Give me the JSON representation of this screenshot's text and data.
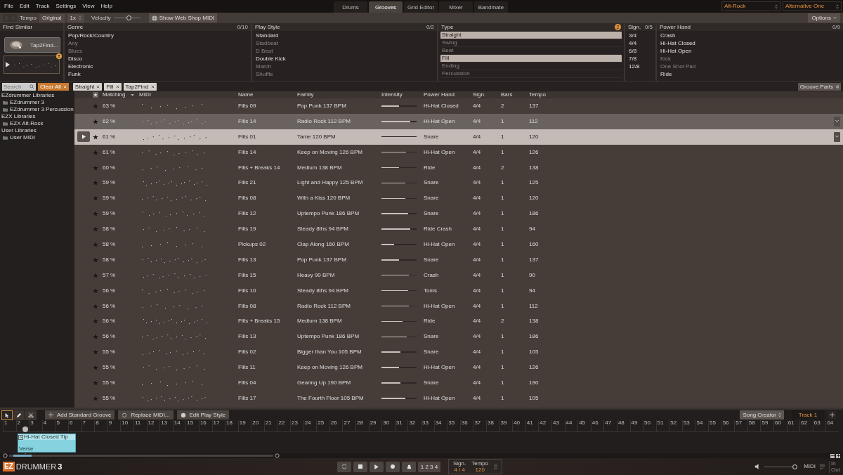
{
  "menu": [
    "File",
    "Edit",
    "Track",
    "Settings",
    "View",
    "Help"
  ],
  "tabs": [
    {
      "label": "Drums",
      "selected": false
    },
    {
      "label": "Grooves",
      "selected": true
    },
    {
      "label": "Grid Editor",
      "selected": false
    },
    {
      "label": "Mixer",
      "selected": false
    },
    {
      "label": "Bandmate",
      "selected": false
    }
  ],
  "presets": [
    "Alt-Rock",
    "Alternative One"
  ],
  "toolbar": {
    "tempo_label": "Tempo",
    "tempo_value": "Original",
    "multiplier": "1x",
    "velocity_label": "Velocity",
    "velocity": {
      "level": 0.55
    },
    "web_shop_button": "Show Web Shop MIDI",
    "options_button": "Options"
  },
  "find_similar": {
    "title": "Find Similar",
    "tap_button": "Tap2Find..."
  },
  "filters": [
    {
      "title": "Genre",
      "count": "0/10",
      "items": [
        {
          "label": "Pop/Rock/Country",
          "disabled": false,
          "selected": false
        },
        {
          "label": "Any",
          "disabled": true,
          "selected": false
        },
        {
          "label": "Blues",
          "disabled": true,
          "selected": false
        },
        {
          "label": "Disco",
          "disabled": false,
          "selected": false
        },
        {
          "label": "Electronic",
          "disabled": false,
          "selected": false
        },
        {
          "label": "Funk",
          "disabled": false,
          "selected": false
        }
      ]
    },
    {
      "title": "Play Style",
      "count": "0/2",
      "items": [
        {
          "label": "Standard",
          "disabled": false,
          "selected": false
        },
        {
          "label": "Stadbeat",
          "disabled": true,
          "selected": false
        },
        {
          "label": "D Beat",
          "disabled": true,
          "selected": false
        },
        {
          "label": "Double Kick",
          "disabled": false,
          "selected": false
        },
        {
          "label": "March",
          "disabled": true,
          "selected": false
        },
        {
          "label": "Shuffle",
          "disabled": true,
          "selected": false
        }
      ]
    },
    {
      "title": "Type",
      "badge": "2",
      "items": [
        {
          "label": "Straight",
          "disabled": false,
          "selected": true
        },
        {
          "label": "Swing",
          "disabled": true,
          "selected": false
        },
        {
          "label": "Beat",
          "disabled": true,
          "selected": false
        },
        {
          "label": "Fill",
          "disabled": false,
          "selected": true
        },
        {
          "label": "Ending",
          "disabled": true,
          "selected": false
        },
        {
          "label": "Percussion",
          "disabled": true,
          "selected": false
        }
      ]
    },
    {
      "title": "Sign.",
      "count": "0/5",
      "items": [
        {
          "label": "3/4",
          "disabled": false,
          "selected": false
        },
        {
          "label": "4/4",
          "disabled": false,
          "selected": false
        },
        {
          "label": "6/8",
          "disabled": false,
          "selected": false
        },
        {
          "label": "7/8",
          "disabled": false,
          "selected": false
        },
        {
          "label": "12/8",
          "disabled": false,
          "selected": false
        }
      ]
    },
    {
      "title": "Power Hand",
      "count": "0/9",
      "items": [
        {
          "label": "Crash",
          "disabled": false,
          "selected": false
        },
        {
          "label": "Hi-Hat Closed",
          "disabled": false,
          "selected": false
        },
        {
          "label": "Hi-Hat Open",
          "disabled": false,
          "selected": false
        },
        {
          "label": "Kick",
          "disabled": true,
          "selected": false
        },
        {
          "label": "One Shot Pad",
          "disabled": true,
          "selected": false
        },
        {
          "label": "Ride",
          "disabled": false,
          "selected": false
        }
      ]
    }
  ],
  "search": {
    "placeholder": "Search"
  },
  "clear_button": "Clear All",
  "tags": [
    "Straight",
    "Fill",
    "Tap2Find"
  ],
  "groove_parts_button": "Groove Parts",
  "libraries": [
    {
      "label": "EZdrummer Libraries",
      "children": [
        {
          "label": "EZdrummer 3"
        },
        {
          "label": "EZdrummer 3 Percussion"
        }
      ]
    },
    {
      "label": "EZX Libraries",
      "children": [
        {
          "label": "EZX Alt-Rock"
        }
      ]
    },
    {
      "label": "User Libraries",
      "children": [
        {
          "label": "User MIDI"
        }
      ]
    }
  ],
  "table": {
    "columns": [
      "Matching",
      "MIDI",
      "Name",
      "Family",
      "Intensity",
      "Power Hand",
      "Sign.",
      "Bars",
      "Tempo"
    ],
    "rows": [
      {
        "matching": "63 %",
        "name": "Fills 09",
        "family": "Pop Punk 137 BPM",
        "level": 0.5,
        "power_hand": "Hi-Hat Closed",
        "sign": "4/4",
        "bars": "2",
        "tempo": "137",
        "selected": false,
        "hovered": false
      },
      {
        "matching": "62 %",
        "name": "Fills 14",
        "family": "Radio Rock 112 BPM",
        "level": 0.82,
        "power_hand": "Hi-Hat Open",
        "sign": "4/4",
        "bars": "1",
        "tempo": "112",
        "selected": false,
        "hovered": true
      },
      {
        "matching": "61 %",
        "name": "Fills 01",
        "family": "Tame 120 BPM",
        "level": 1,
        "power_hand": "Snare",
        "sign": "4/4",
        "bars": "1",
        "tempo": "120",
        "selected": true,
        "hovered": false
      },
      {
        "matching": "61 %",
        "name": "Fills 14",
        "family": "Keep on Moving 126 BPM",
        "level": 0.7,
        "power_hand": "Hi-Hat Open",
        "sign": "4/4",
        "bars": "1",
        "tempo": "126",
        "selected": false,
        "hovered": false
      },
      {
        "matching": "60 %",
        "name": "Fills + Breaks 14",
        "family": "Medium 138 BPM",
        "level": 0.5,
        "power_hand": "Ride",
        "sign": "4/4",
        "bars": "2",
        "tempo": "138",
        "selected": false,
        "hovered": false
      },
      {
        "matching": "59 %",
        "name": "Fills 21",
        "family": "Light and Happy 125 BPM",
        "level": 0.67,
        "power_hand": "Snare",
        "sign": "4/4",
        "bars": "1",
        "tempo": "125",
        "selected": false,
        "hovered": false
      },
      {
        "matching": "59 %",
        "name": "Fills 08",
        "family": "With a Kiss 120 BPM",
        "level": 0.67,
        "power_hand": "Snare",
        "sign": "4/4",
        "bars": "1",
        "tempo": "120",
        "selected": false,
        "hovered": false
      },
      {
        "matching": "59 %",
        "name": "Fills 12",
        "family": "Uptempo Punk 186 BPM",
        "level": 0.75,
        "power_hand": "Snare",
        "sign": "4/4",
        "bars": "1",
        "tempo": "186",
        "selected": false,
        "hovered": false
      },
      {
        "matching": "58 %",
        "name": "Fills 19",
        "family": "Steady 8ths 94 BPM",
        "level": 0.82,
        "power_hand": "Ride Crash",
        "sign": "4/4",
        "bars": "1",
        "tempo": "94",
        "selected": false,
        "hovered": false
      },
      {
        "matching": "58 %",
        "name": "Pickups 02",
        "family": "Clap Along 160 BPM",
        "level": 0.35,
        "power_hand": "Hi-Hat Open",
        "sign": "4/4",
        "bars": "1",
        "tempo": "160",
        "selected": false,
        "hovered": false
      },
      {
        "matching": "58 %",
        "name": "Fills 13",
        "family": "Pop Punk 137 BPM",
        "level": 0.5,
        "power_hand": "Snare",
        "sign": "4/4",
        "bars": "1",
        "tempo": "137",
        "selected": false,
        "hovered": false
      },
      {
        "matching": "57 %",
        "name": "Fills 15",
        "family": "Heavy 90 BPM",
        "level": 0.78,
        "power_hand": "Crash",
        "sign": "4/4",
        "bars": "1",
        "tempo": "90",
        "selected": false,
        "hovered": false
      },
      {
        "matching": "56 %",
        "name": "Fills 10",
        "family": "Steady 8ths 94 BPM",
        "level": 0.75,
        "power_hand": "Toms",
        "sign": "4/4",
        "bars": "1",
        "tempo": "94",
        "selected": false,
        "hovered": false
      },
      {
        "matching": "56 %",
        "name": "Fills 08",
        "family": "Radio Rock 112 BPM",
        "level": 0.78,
        "power_hand": "Hi-Hat Open",
        "sign": "4/4",
        "bars": "1",
        "tempo": "112",
        "selected": false,
        "hovered": false
      },
      {
        "matching": "56 %",
        "name": "Fills + Breaks 15",
        "family": "Medium 138 BPM",
        "level": 0.6,
        "power_hand": "Ride",
        "sign": "4/4",
        "bars": "2",
        "tempo": "138",
        "selected": false,
        "hovered": false
      },
      {
        "matching": "56 %",
        "name": "Fills 13",
        "family": "Uptempo Punk 186 BPM",
        "level": 0.72,
        "power_hand": "Snare",
        "sign": "4/4",
        "bars": "1",
        "tempo": "186",
        "selected": false,
        "hovered": false
      },
      {
        "matching": "55 %",
        "name": "Fills 02",
        "family": "Bigger than You 105 BPM",
        "level": 0.53,
        "power_hand": "Snare",
        "sign": "4/4",
        "bars": "1",
        "tempo": "105",
        "selected": false,
        "hovered": false
      },
      {
        "matching": "55 %",
        "name": "Fills 11",
        "family": "Keep on Moving 126 BPM",
        "level": 0.5,
        "power_hand": "Hi-Hat Open",
        "sign": "4/4",
        "bars": "1",
        "tempo": "126",
        "selected": false,
        "hovered": false
      },
      {
        "matching": "55 %",
        "name": "Fills 04",
        "family": "Gearing Up 190 BPM",
        "level": 0.53,
        "power_hand": "Snare",
        "sign": "4/4",
        "bars": "1",
        "tempo": "190",
        "selected": false,
        "hovered": false
      },
      {
        "matching": "55 %",
        "name": "Fills 17",
        "family": "The Fourth Floor 105 BPM",
        "level": 0.68,
        "power_hand": "Hi-Hat Open",
        "sign": "4/4",
        "bars": "1",
        "tempo": "105",
        "selected": false,
        "hovered": false
      }
    ]
  },
  "tools": [
    {
      "kind": "pointer",
      "selected": true
    },
    {
      "kind": "pencil",
      "selected": false
    },
    {
      "kind": "scissors",
      "selected": false
    }
  ],
  "edit_buttons": [
    {
      "kind": "add",
      "label": "Add Standard Groove"
    },
    {
      "kind": "replace",
      "label": "Replace MIDI..."
    },
    {
      "kind": "style",
      "label": "Edit Play Style"
    }
  ],
  "song_creator_button": "Song Creator",
  "track_tab": "Track 1",
  "ruler": [
    "1",
    "2",
    "3",
    "4",
    "5",
    "6",
    "7",
    "8",
    "9",
    "10",
    "11",
    "12",
    "13",
    "14",
    "15",
    "16",
    "17",
    "18",
    "19",
    "20",
    "21",
    "22",
    "23",
    "24",
    "25",
    "26",
    "27",
    "28",
    "29",
    "30",
    "31",
    "32",
    "33",
    "34",
    "35",
    "36",
    "37",
    "38",
    "39",
    "40",
    "41",
    "42",
    "43",
    "44",
    "45",
    "46",
    "47",
    "48",
    "49",
    "50",
    "51",
    "52",
    "53",
    "54",
    "55",
    "56",
    "57",
    "58",
    "59",
    "60",
    "61",
    "62",
    "63",
    "64"
  ],
  "clip": {
    "title": "Hi-Hat Closed Tip",
    "part": "Verse"
  },
  "logo": {
    "badge": "EZ",
    "name": "DRUMMER",
    "number": "3"
  },
  "counter": "1 2 3 4",
  "sign": {
    "label": "Sign.",
    "value": "4 / 4"
  },
  "tempo": {
    "label": "Tempo",
    "value": "120"
  },
  "volume": {
    "level": 0.92
  },
  "midi_label": "MIDI",
  "io": [
    "In",
    "Out"
  ]
}
